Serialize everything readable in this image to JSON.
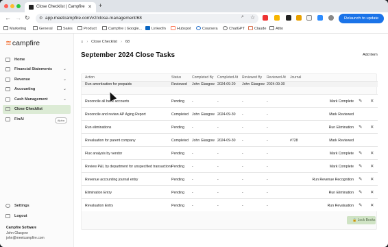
{
  "browser": {
    "tab_title": "Close Checklist | Campfire",
    "url": "app.meetcampfire.com/v2/close-management/68",
    "relaunch_label": "Relaunch to update",
    "bookmarks": [
      "Marketing",
      "General",
      "Sales",
      "Product",
      "Campfire | Google...",
      "LinkedIn",
      "Hubspot",
      "Coursera",
      "ChatGPT",
      "Claude",
      "Attio"
    ]
  },
  "sidebar": {
    "brand": "campfire",
    "items": [
      {
        "label": "Home"
      },
      {
        "label": "Financial Statements"
      },
      {
        "label": "Revenue"
      },
      {
        "label": "Accounting"
      },
      {
        "label": "Cash Management"
      },
      {
        "label": "Close Checklist"
      },
      {
        "label": "FinAI",
        "badge": "Alpha"
      }
    ],
    "settings_label": "Settings",
    "logout_label": "Logout",
    "company": "Campfire Software",
    "user_name": "John Glasgow",
    "user_email": "john@meetcampfire.com"
  },
  "main": {
    "breadcrumb": [
      "Close Checklist",
      "68"
    ],
    "title": "September 2024 Close Tasks",
    "add_item_label": "Add item",
    "lock_books_label": "Lock Books",
    "columns": [
      "Action",
      "Status",
      "Completed By",
      "Completed At",
      "Reviewed By",
      "Reviewed At",
      "Journal"
    ],
    "rows": [
      {
        "action": "Run amortization for prepaids",
        "status": "Reviewed",
        "completed_by": "John Glasgow",
        "completed_at": "2024-09-20",
        "reviewed_by": "John Glasgow",
        "reviewed_at": "2024-09-30",
        "journal": "",
        "button": ""
      },
      {
        "action": "Reconcile all bank accounts",
        "status": "Pending",
        "completed_by": "-",
        "completed_at": "-",
        "reviewed_by": "-",
        "reviewed_at": "-",
        "journal": "",
        "button": "Mark Complete"
      },
      {
        "action": "Reconcile and review AP Aging Report",
        "status": "Completed",
        "completed_by": "John Glasgow",
        "completed_at": "2024-09-30",
        "reviewed_by": "-",
        "reviewed_at": "-",
        "journal": "",
        "button": "Mark Reviewed"
      },
      {
        "action": "Run eliminations",
        "status": "Pending",
        "completed_by": "-",
        "completed_at": "-",
        "reviewed_by": "-",
        "reviewed_at": "-",
        "journal": "",
        "button": "Run Elimination"
      },
      {
        "action": "Revaluation for parent company",
        "status": "Completed",
        "completed_by": "John Glasgow",
        "completed_at": "2024-09-30",
        "reviewed_by": "-",
        "reviewed_at": "-",
        "journal": "#728",
        "button": "Mark Reviewed"
      },
      {
        "action": "Flux analysis by vendor",
        "status": "Pending",
        "completed_by": "-",
        "completed_at": "-",
        "reviewed_by": "-",
        "reviewed_at": "-",
        "journal": "",
        "button": "Mark Complete"
      },
      {
        "action": "Review P&L by department for unspecified transactions",
        "status": "Pending",
        "completed_by": "-",
        "completed_at": "-",
        "reviewed_by": "-",
        "reviewed_at": "-",
        "journal": "",
        "button": "Mark Complete"
      },
      {
        "action": "Revenue accounting journal entry",
        "status": "Pending",
        "completed_by": "-",
        "completed_at": "-",
        "reviewed_by": "-",
        "reviewed_at": "-",
        "journal": "",
        "button": "Run Revenue Recognition"
      },
      {
        "action": "Elimination Entry",
        "status": "Pending",
        "completed_by": "-",
        "completed_at": "-",
        "reviewed_by": "-",
        "reviewed_at": "-",
        "journal": "",
        "button": "Run Elimination"
      },
      {
        "action": "Revaluation Entry",
        "status": "Pending",
        "completed_by": "-",
        "completed_at": "-",
        "reviewed_by": "-",
        "reviewed_at": "-",
        "journal": "",
        "button": "Run Revaluation"
      }
    ]
  },
  "colors": {
    "accent": "#f26522",
    "active_nav": "#dcebd5",
    "relaunch": "#1a73e8",
    "lock_button": "#cfe3c4"
  }
}
